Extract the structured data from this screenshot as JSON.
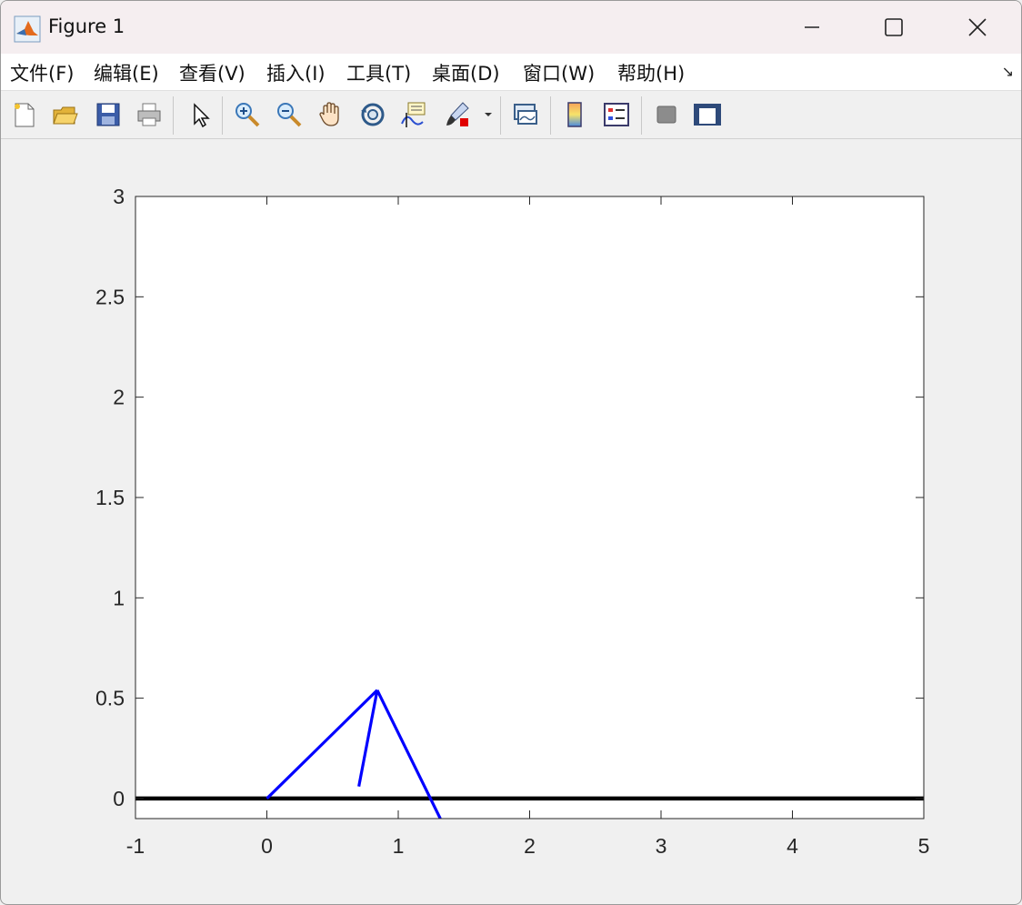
{
  "window": {
    "title": "Figure 1",
    "controls": {
      "minimize": "minimize",
      "maximize": "maximize",
      "close": "close"
    }
  },
  "menubar": {
    "items": [
      {
        "label": "文件(F)"
      },
      {
        "label": "编辑(E)"
      },
      {
        "label": "查看(V)"
      },
      {
        "label": "插入(I)"
      },
      {
        "label": "工具(T)"
      },
      {
        "label": "桌面(D)"
      },
      {
        "label": "窗口(W)"
      },
      {
        "label": "帮助(H)"
      }
    ]
  },
  "toolbar": {
    "buttons": [
      {
        "icon": "new-figure-icon"
      },
      {
        "icon": "open-icon"
      },
      {
        "icon": "save-icon"
      },
      {
        "icon": "print-icon"
      },
      {
        "icon": "pointer-icon"
      },
      {
        "icon": "zoom-in-icon"
      },
      {
        "icon": "zoom-out-icon"
      },
      {
        "icon": "pan-hand-icon"
      },
      {
        "icon": "rotate-3d-icon"
      },
      {
        "icon": "data-cursor-icon"
      },
      {
        "icon": "brush-icon"
      },
      {
        "icon": "link-plot-icon"
      },
      {
        "icon": "colorbar-icon"
      },
      {
        "icon": "legend-icon"
      },
      {
        "icon": "hide-plot-tools-icon"
      },
      {
        "icon": "show-plot-tools-icon"
      }
    ]
  },
  "chart_data": {
    "type": "line",
    "title": "",
    "xlabel": "",
    "ylabel": "",
    "xlim": [
      -1,
      5
    ],
    "ylim": [
      -0.1,
      3
    ],
    "xticks": [
      "-1",
      "0",
      "1",
      "2",
      "3",
      "4",
      "5"
    ],
    "xtick_values": [
      -1,
      0,
      1,
      2,
      3,
      4,
      5
    ],
    "yticks": [
      "0",
      "0.5",
      "1",
      "1.5",
      "2",
      "2.5",
      "3"
    ],
    "ytick_values": [
      0,
      0.5,
      1,
      1.5,
      2,
      2.5,
      3
    ],
    "grid": false,
    "legend": "none",
    "series": [
      {
        "color": "#000000",
        "x": [
          -1,
          5
        ],
        "y": [
          0,
          0
        ]
      },
      {
        "color": "#0000ff",
        "x": [
          0,
          0.84
        ],
        "y": [
          0,
          0.54
        ]
      },
      {
        "color": "#0000ff",
        "x": [
          0.84,
          0.7
        ],
        "y": [
          0.54,
          0.06
        ]
      },
      {
        "color": "#0000ff",
        "x": [
          0.84,
          1.32
        ],
        "y": [
          0.54,
          -0.1
        ]
      }
    ]
  }
}
